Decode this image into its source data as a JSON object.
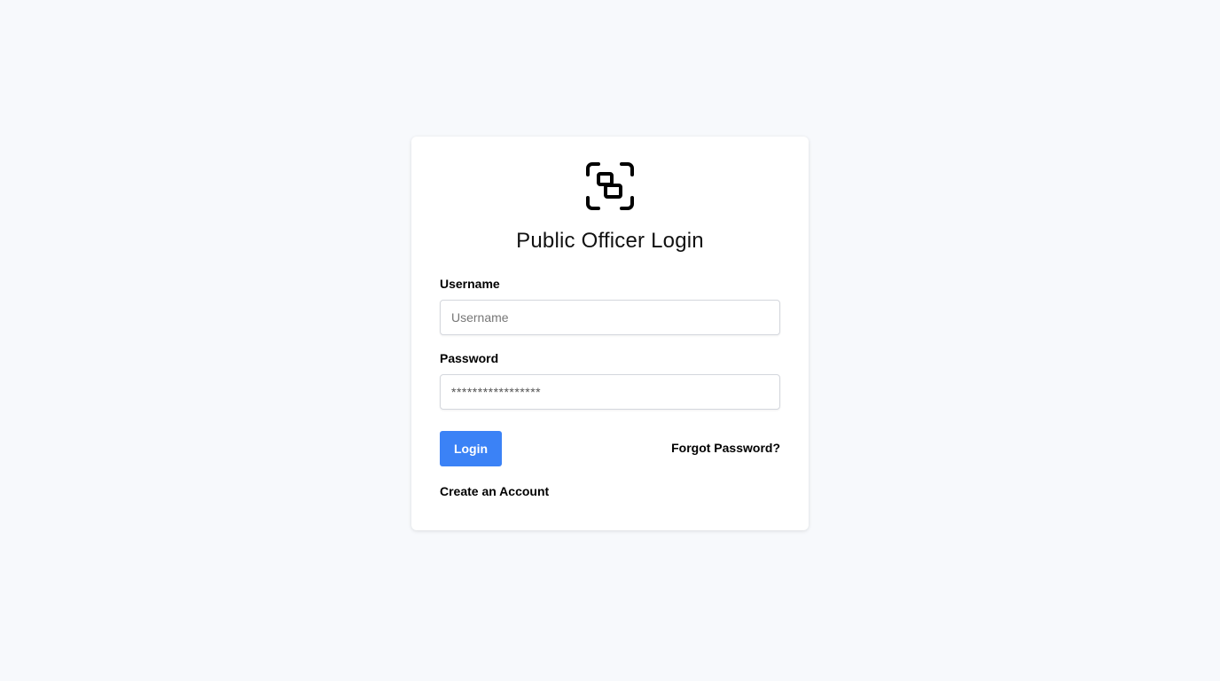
{
  "logo": {
    "icon": "linked-squares-scan-icon"
  },
  "title": "Public Officer Login",
  "username": {
    "label": "Username",
    "placeholder": "Username",
    "value": ""
  },
  "password": {
    "label": "Password",
    "masked_value": "*****************"
  },
  "actions": {
    "login_label": "Login",
    "forgot_label": "Forgot Password?",
    "create_label": "Create an Account"
  },
  "colors": {
    "accent": "#3b82f6",
    "background": "#f7f9fc",
    "card": "#ffffff"
  }
}
